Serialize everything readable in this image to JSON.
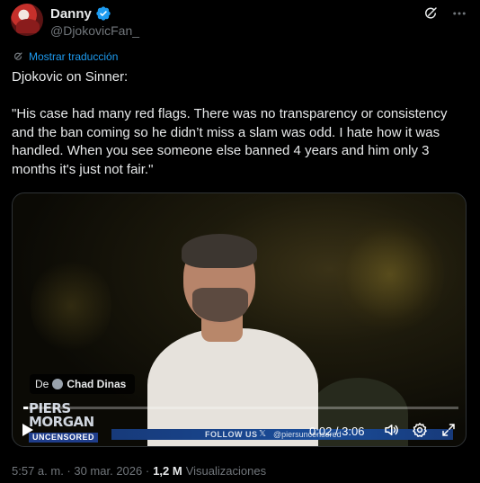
{
  "author": {
    "name": "Danny",
    "handle": "@DjokovicFan_",
    "verified": true
  },
  "translate_label": "Mostrar traducción",
  "text": "Djokovic on Sinner:\n\n\"His case had many red flags. There was no transparency or consistency and the ban coming so he didn’t miss a slam was odd. I hate how it was handled. When you see someone else banned 4 years and him only 3 months it's just not fair.\"",
  "video": {
    "source_prefix": "De",
    "source_name": "Chad Dinas",
    "logo_line1": "PIERS",
    "logo_line2": "MORGAN",
    "logo_line3": "UNCENSORED",
    "ticker_follow": "FOLLOW US",
    "ticker_x": "𝕏",
    "ticker_handle": "@piersuncensored",
    "time": "0:02 / 3:06",
    "progress": 0.011
  },
  "meta": {
    "timestamp": "5:57 a. m. · 30 mar. 2026 ·",
    "views": "1,2 M",
    "views_label": "Visualizaciones"
  },
  "colors": {
    "accent": "#1d9bf0",
    "muted": "#71767b",
    "text": "#e7e9ea",
    "bg": "#000000"
  },
  "icons": [
    "verified-badge-icon",
    "grok-icon",
    "more-icon",
    "translate-icon",
    "play-icon",
    "volume-icon",
    "settings-icon",
    "fullscreen-icon"
  ]
}
